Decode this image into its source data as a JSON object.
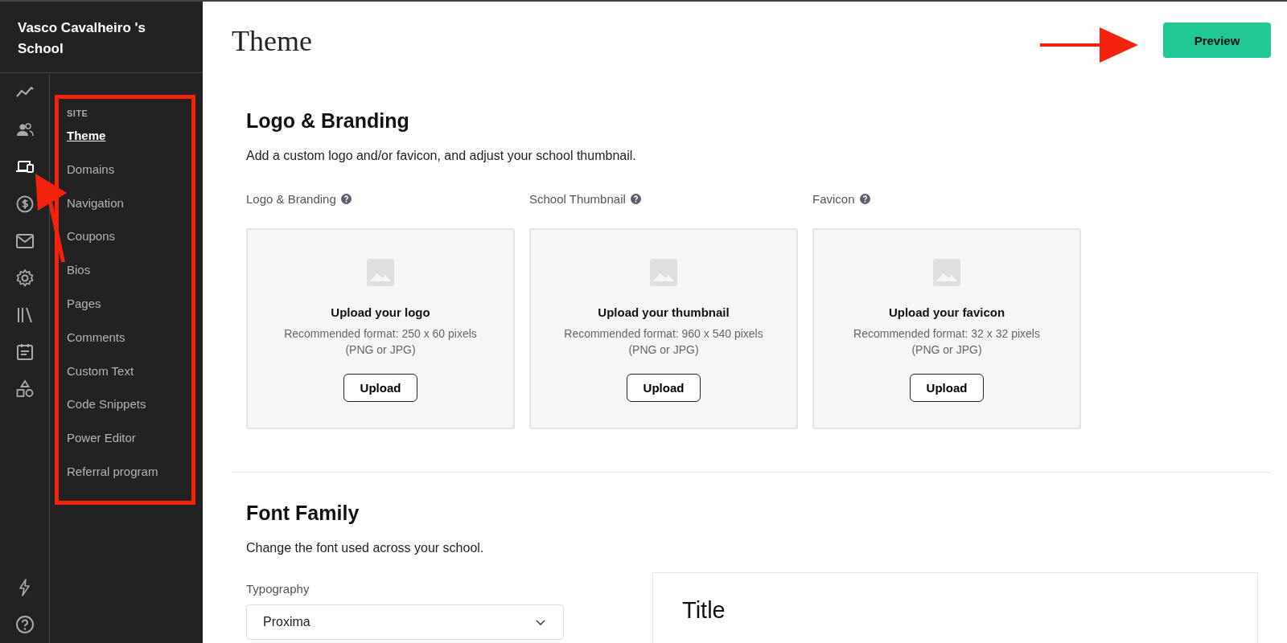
{
  "school": {
    "name": "Vasco Cavalheiro 's School"
  },
  "rail": [
    {
      "kind": "chart",
      "selected": false
    },
    {
      "kind": "people",
      "selected": false
    },
    {
      "kind": "devices",
      "selected": true
    },
    {
      "kind": "dollar",
      "selected": false
    },
    {
      "kind": "mail",
      "selected": false
    },
    {
      "kind": "gear",
      "selected": false
    },
    {
      "kind": "library",
      "selected": false
    },
    {
      "kind": "calendar",
      "selected": false
    },
    {
      "kind": "shapes",
      "selected": false
    }
  ],
  "rail_bottom": [
    {
      "kind": "bolt",
      "selected": false
    },
    {
      "kind": "help",
      "selected": false
    }
  ],
  "submenu": {
    "heading": "SITE",
    "items": [
      {
        "label": "Theme",
        "selected": true
      },
      {
        "label": "Domains",
        "selected": false
      },
      {
        "label": "Navigation",
        "selected": false
      },
      {
        "label": "Coupons",
        "selected": false
      },
      {
        "label": "Bios",
        "selected": false
      },
      {
        "label": "Pages",
        "selected": false
      },
      {
        "label": "Comments",
        "selected": false
      },
      {
        "label": "Custom Text",
        "selected": false
      },
      {
        "label": "Code Snippets",
        "selected": false
      },
      {
        "label": "Power Editor",
        "selected": false
      },
      {
        "label": "Referral program",
        "selected": false
      }
    ]
  },
  "page": {
    "title": "Theme",
    "preview_button": "Preview"
  },
  "branding": {
    "heading": "Logo & Branding",
    "description": "Add a custom logo and/or favicon, and adjust your school thumbnail.",
    "uploads": [
      {
        "label": "Logo & Branding",
        "title": "Upload your logo",
        "format": "Recommended format: 250 x 60 pixels",
        "types": "(PNG or JPG)",
        "button": "Upload"
      },
      {
        "label": "School Thumbnail",
        "title": "Upload your thumbnail",
        "format": "Recommended format: 960 x 540 pixels",
        "types": "(PNG or JPG)",
        "button": "Upload"
      },
      {
        "label": "Favicon",
        "title": "Upload your favicon",
        "format": "Recommended format: 32 x 32 pixels",
        "types": "(PNG or JPG)",
        "button": "Upload"
      }
    ]
  },
  "font_family": {
    "heading": "Font Family",
    "description": "Change the font used across your school.",
    "typography_label": "Typography",
    "typography_value": "Proxima",
    "preview_title": "Title"
  }
}
